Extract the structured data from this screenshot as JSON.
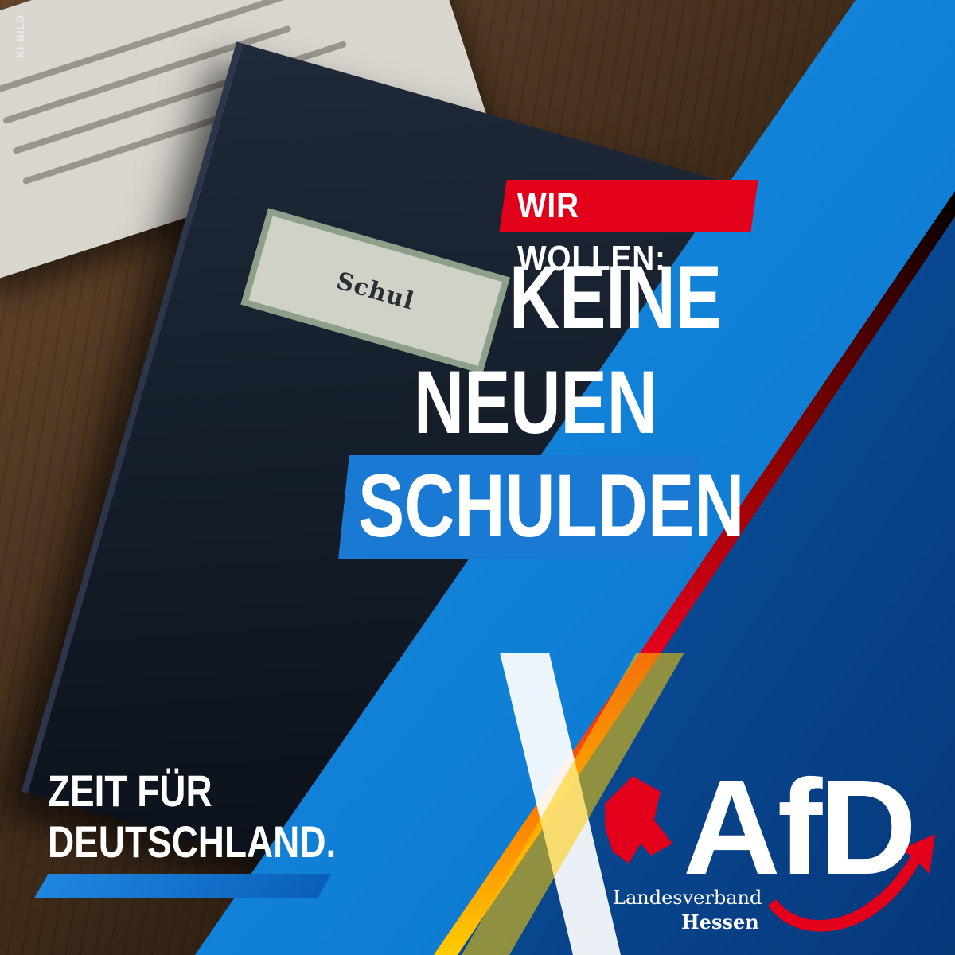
{
  "watermark": "KI-BILD",
  "folder_label": "Schul",
  "tagline": "WIR WOLLEN:",
  "headline": {
    "line1": "KEINE",
    "line2": "NEUEN",
    "line3": "SCHULDEN"
  },
  "slogan": {
    "line1": "ZEIT FÜR",
    "line2": "DEUTSCHLAND."
  },
  "logo": {
    "brand": "AfD",
    "line1": "Landesverband",
    "line2": "Hessen"
  },
  "colors": {
    "blue": "#0d8ae0",
    "dark_blue": "#063f86",
    "red": "#e3001b",
    "gold": "#ffcc00",
    "black": "#000000"
  },
  "icons": [
    "hessian-lion-icon",
    "red-arrow-swoosh-icon"
  ]
}
